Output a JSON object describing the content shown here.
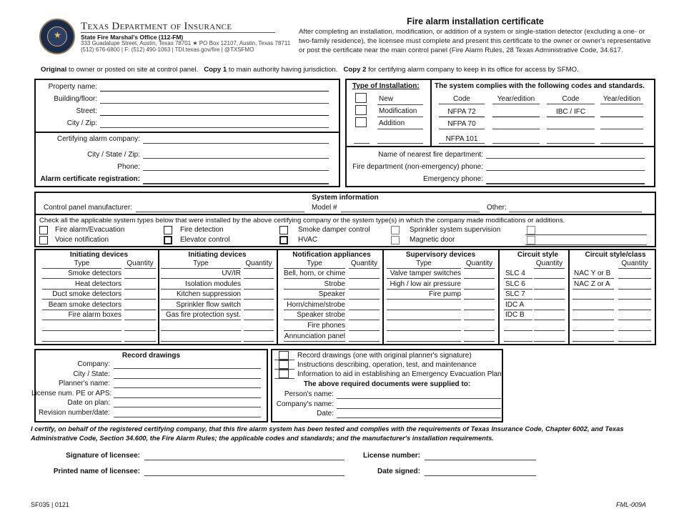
{
  "header": {
    "org_name": "Texas Department of Insurance",
    "office": "State Fire Marshal's Office (112-FM)",
    "address": "333 Guadalupe Street, Austin, Texas 78701 ★ PO Box 12107, Austin, Texas 78711",
    "contact": "(512) 676-6800 | F: (512) 490-1063 | TDI.texas.gov/fire | @TXSFMO",
    "seal_icon": "state-fire-marshal-seal",
    "title": "Fire alarm installation certificate",
    "intro": "After completing an installation, modification, or addition of a system or single-station detector (excluding a one- or two-family residence), the licensee must complete and present this certificate to the owner or owner's representative or post the certificate near the main control panel (Fire Alarm Rules, 28 Texas Administrative Code, 34.617."
  },
  "copies": {
    "original_b": "Original",
    "original_t": " to owner or posted on site at control panel.",
    "copy1_b": "Copy 1",
    "copy1_t": " to main authority having jurisdiction.",
    "copy2_b": "Copy 2",
    "copy2_t": " for certifying alarm company to keep in its office for access by SFMO."
  },
  "property": {
    "fields": [
      "Property name:",
      "Building/floor:",
      "Street:",
      "City / Zip:"
    ]
  },
  "company": {
    "fields": [
      "Certifying alarm company:",
      "City / State / Zip:",
      "Phone:"
    ],
    "registration": "Alarm certificate registration:"
  },
  "installation": {
    "heading": "Type of Installation:",
    "options": [
      "New",
      "Modification",
      "Addition"
    ]
  },
  "codes": {
    "heading": "The system complies with the following codes and standards.",
    "col_code": "Code",
    "col_year": "Year/edition",
    "left_codes": [
      "NFPA 72",
      "NFPA 70",
      "NFPA 101"
    ],
    "right_codes": [
      "IBC / IFC"
    ]
  },
  "fire_dept": {
    "fields": [
      "Name of nearest fire department:",
      "Fire department (non-emergency) phone:",
      "Emergency phone:"
    ]
  },
  "system": {
    "heading": "System information",
    "panel_manufacturer": "Control panel manufacturer:",
    "model": "Model #",
    "other": "Other:",
    "check_instruction": "Check all the applicable system types below that were installed by the above certifying company or the system type(s) in which the company made modifications or additions.",
    "types_row1": [
      "Fire alarm/Evacuation",
      "Fire detection",
      "Smoke damper control",
      "Sprinkler system supervision"
    ],
    "types_row2": [
      "Voice notification",
      "Elevator control",
      "HVAC",
      "Magnetic door"
    ]
  },
  "devices": {
    "type_label": "Type",
    "qty_label": "Quantity",
    "initiating1": {
      "heading": "Initiating devices",
      "items": [
        "Smoke detectors",
        "Heat detectors",
        "Duct smoke detectors",
        "Beam smoke detectors",
        "Fire alarm boxes"
      ]
    },
    "initiating2": {
      "heading": "Initiating devices",
      "items": [
        "UV/IR",
        "Isolation modules",
        "Kitchen suppression",
        "Sprinkler flow switch",
        "Gas fire protection syst."
      ]
    },
    "notification": {
      "heading": "Notification appliances",
      "items": [
        "Bell, horn, or chime",
        "Strobe",
        "Speaker",
        "Horn/chime/strobe",
        "Speaker strobe",
        "Fire phones",
        "Annunciation panel"
      ]
    },
    "supervisory": {
      "heading": "Supervisory devices",
      "items": [
        "Valve tamper switches",
        "High / low air pressure",
        "Fire pump"
      ]
    },
    "circuit_style": {
      "heading": "Circuit style",
      "items": [
        "SLC 4",
        "SLC 6",
        "SLC 7",
        "IDC A",
        "IDC B"
      ]
    },
    "circuit_class": {
      "heading": "Circuit style/class",
      "items": [
        "NAC Y or B",
        "NAC Z or A"
      ]
    }
  },
  "record_drawings": {
    "heading": "Record drawings",
    "fields": [
      "Company:",
      "City / State:",
      "Planner's name:",
      "License num. PE or APS:",
      "Date on plan:",
      "Revision number/date:"
    ]
  },
  "documents": {
    "items": [
      "Record drawings (one with original planner's signature)",
      "Instructions describing, operation, test, and maintenance",
      "Information to aid in establishing an Emergency Evacuation Plan"
    ],
    "supplied_heading": "The above required documents were supplied to:",
    "fields": [
      "Person's name:",
      "Company's name:",
      "Date:"
    ]
  },
  "certification": {
    "text": "I certify, on behalf of the registered certifying company, that this fire alarm system has been tested and complies with the requirements of Texas Insurance Code, Chapter 6002, and Texas Administrative Code, Section 34.600, the Fire Alarm Rules; the applicable codes and standards; and the manufacturer's installation requirements.",
    "signature": "Signature of licensee:",
    "printed_name": "Printed name of licensee:",
    "license_number": "License number:",
    "date_signed": "Date signed:"
  },
  "footer": {
    "form_id": "SF035 | 0121",
    "form_code": "FML-009A"
  }
}
